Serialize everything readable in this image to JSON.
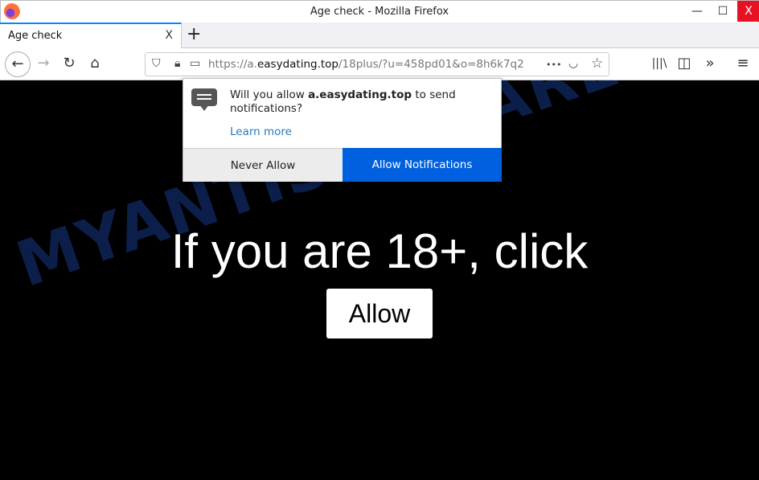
{
  "window": {
    "title": "Age check - Mozilla Firefox",
    "minimize": "—",
    "maximize": "☐",
    "close": "X"
  },
  "tab": {
    "title": "Age check",
    "close": "X",
    "new_tab": "+"
  },
  "nav": {
    "back": "←",
    "forward": "→",
    "reload": "↻",
    "home": "⌂",
    "url_prefix": "https://a.",
    "url_domain": "easydating.top",
    "url_path": "/18plus/?u=458pd01&o=8h6k7q2",
    "more": "•••",
    "pocket": "◡",
    "bookmark": "☆",
    "library": "|||\\",
    "sidebar": "◫",
    "overflow": "»",
    "menu": "≡"
  },
  "popup": {
    "msg_prefix": "Will you allow ",
    "msg_domain": "a.easydating.top",
    "msg_suffix": " to send notifications?",
    "learn_more": "Learn more",
    "never_allow": "Never Allow",
    "allow_notifications": "Allow Notifications"
  },
  "page": {
    "headline": "If you are 18+, click",
    "allow_button": "Allow",
    "watermark": "MYANTISPYWARE.COM"
  },
  "colors": {
    "accent": "#0060df",
    "close": "#e81123"
  }
}
